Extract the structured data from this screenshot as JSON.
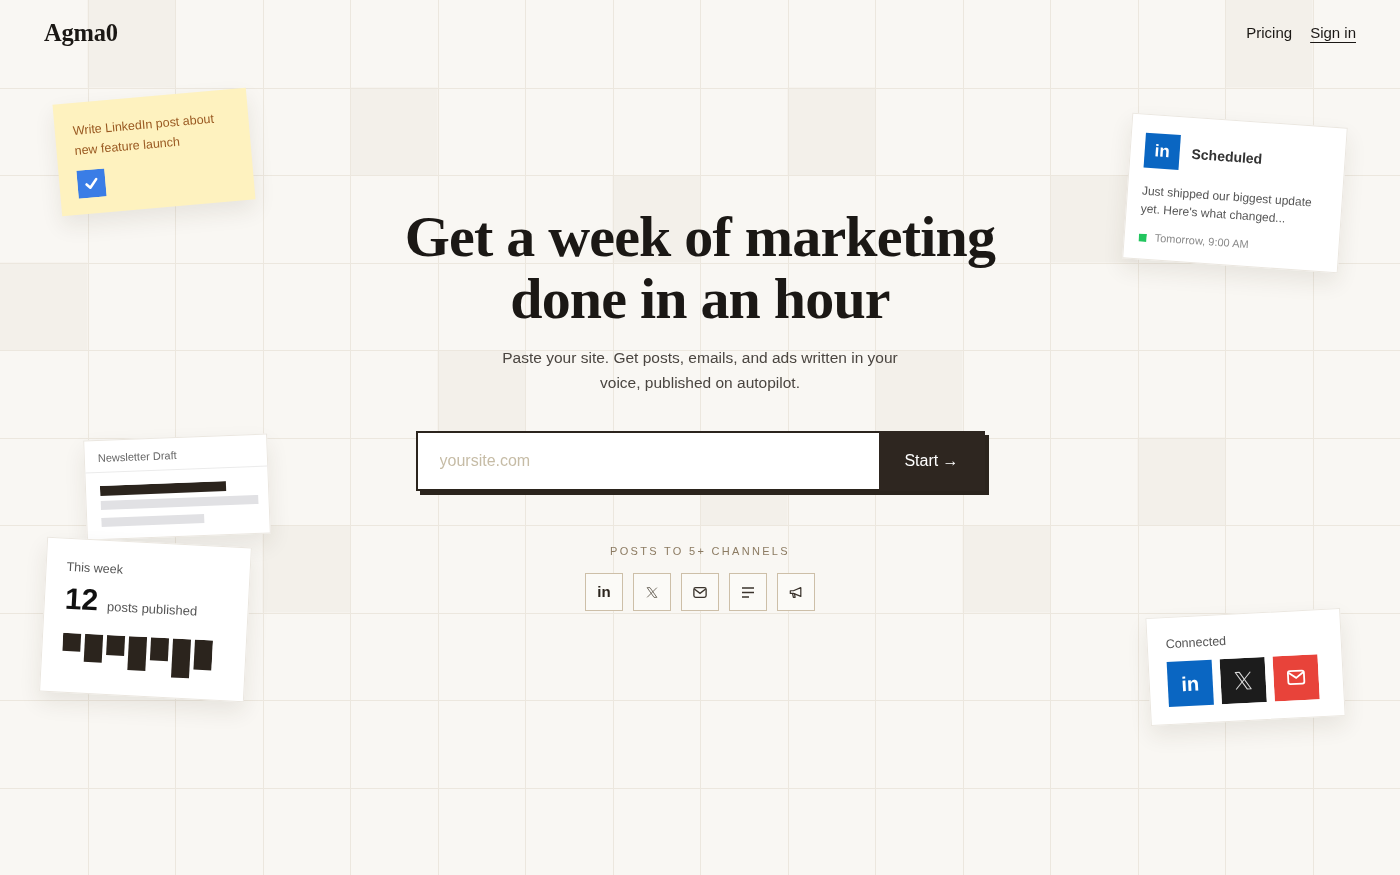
{
  "header": {
    "logo": "Agma0",
    "nav": [
      {
        "label": "Pricing",
        "underlined": false
      },
      {
        "label": "Sign in",
        "underlined": true
      }
    ]
  },
  "task_note": {
    "text": "Write LinkedIn post about new feature launch",
    "checked": true
  },
  "scheduled_post": {
    "glyph": "in",
    "status": "Scheduled",
    "text": "Just shipped our biggest update yet. Here's what changed...",
    "time": "Tomorrow, 9:00 AM"
  },
  "hero": {
    "title": "Get a week of marketing done in an hour",
    "subtitle": "Paste your site. Get posts, emails, and ads written in your voice, published on autopilot."
  },
  "signup": {
    "placeholder": "yoursite.com",
    "button": "Start →"
  },
  "newsletter_draft": {
    "title": "Newsletter Draft"
  },
  "channels": {
    "caption": "POSTS TO 5+ CHANNELS",
    "items": [
      {
        "kind": "linkedin",
        "glyph": "in"
      },
      {
        "kind": "x"
      },
      {
        "kind": "email"
      },
      {
        "kind": "document"
      },
      {
        "kind": "megaphone"
      }
    ]
  },
  "weekly_stats": {
    "label": "This week",
    "count": "12",
    "unit": "posts published"
  },
  "connected": {
    "title": "Connected",
    "accounts": [
      {
        "kind": "linkedin",
        "glyph": "in"
      },
      {
        "kind": "x"
      },
      {
        "kind": "email"
      }
    ]
  }
}
